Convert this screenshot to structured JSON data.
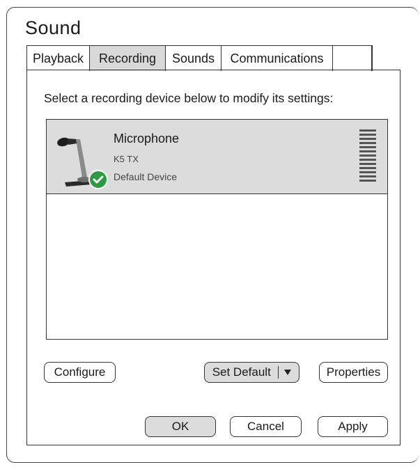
{
  "window": {
    "title": "Sound"
  },
  "tabs": [
    {
      "label": "Playback",
      "active": false
    },
    {
      "label": "Recording",
      "active": true
    },
    {
      "label": "Sounds",
      "active": false
    },
    {
      "label": "Communications",
      "active": false
    }
  ],
  "instruction": "Select a recording device below to modify its settings:",
  "devices": [
    {
      "name": "Microphone",
      "model": "K5 TX",
      "status": "Default Device",
      "selected": true,
      "icon": "microphone-icon",
      "badge": "check-icon"
    }
  ],
  "buttons": {
    "configure": "Configure",
    "set_default": "Set Default",
    "properties": "Properties",
    "ok": "OK",
    "cancel": "Cancel",
    "apply": "Apply"
  },
  "colors": {
    "selected_row": "#dcdcdc",
    "active_tab": "#d9d9d9",
    "check_badge": "#2e9a44"
  }
}
